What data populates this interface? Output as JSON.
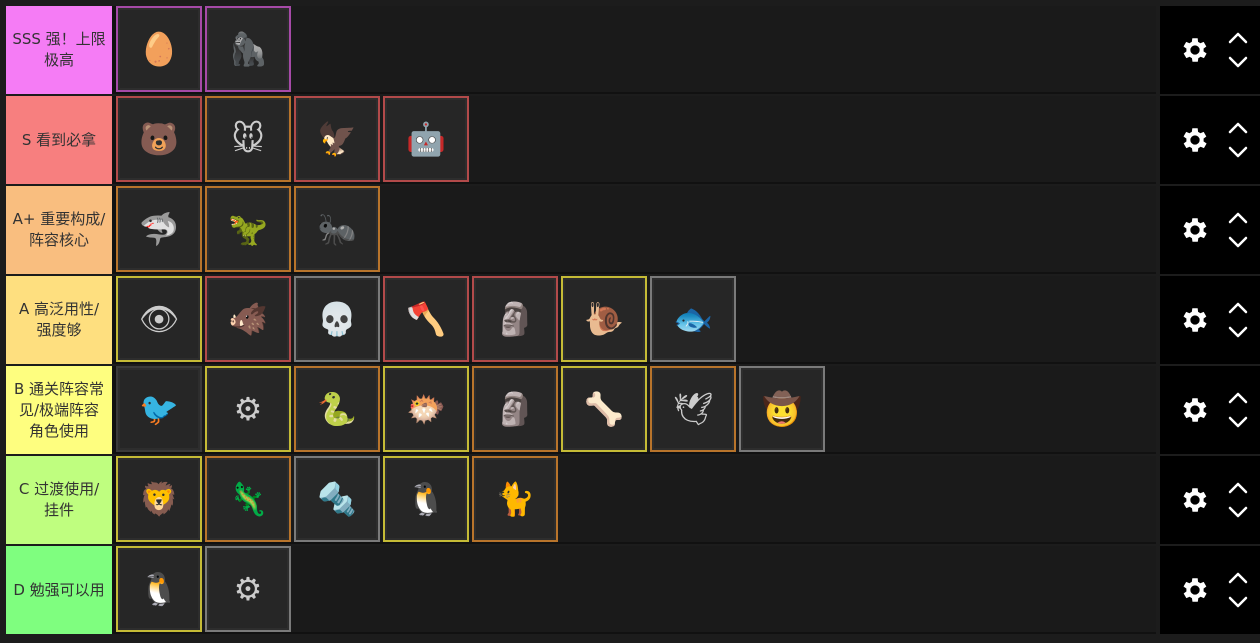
{
  "tiers": [
    {
      "label": "SSS 强！上限极高",
      "color": "#f57cf5",
      "items": [
        {
          "icon": "red-egg-pod-icon",
          "glyph": "🥚",
          "frame": "purple"
        },
        {
          "icon": "white-yeti-robot-icon",
          "glyph": "🦍",
          "frame": "purple"
        }
      ]
    },
    {
      "label": "S 看到必拿",
      "color": "#f77f7f",
      "items": [
        {
          "icon": "brown-bear-icon",
          "glyph": "🐻",
          "frame": "red"
        },
        {
          "icon": "grey-mouse-icon",
          "glyph": "🐭",
          "frame": "orange"
        },
        {
          "icon": "pterodactyl-volcano-icon",
          "glyph": "🦅",
          "frame": "red"
        },
        {
          "icon": "golden-armor-robot-icon",
          "glyph": "🤖",
          "frame": "red"
        }
      ]
    },
    {
      "label": "A+ 重要构成/阵容核心",
      "color": "#f9be7f",
      "items": [
        {
          "icon": "grey-shark-icon",
          "glyph": "🦈",
          "frame": "orange"
        },
        {
          "icon": "green-pterodactyl-icon",
          "glyph": "🦖",
          "frame": "orange"
        },
        {
          "icon": "anteater-icon",
          "glyph": "🐜",
          "frame": "orange"
        }
      ]
    },
    {
      "label": "A 高泛用性/强度够",
      "color": "#fedf7f",
      "items": [
        {
          "icon": "red-eye-drone-icon",
          "glyph": "👁",
          "frame": "yellow"
        },
        {
          "icon": "dark-horned-beast-icon",
          "glyph": "🐗",
          "frame": "red"
        },
        {
          "icon": "skeleton-cat-icon",
          "glyph": "💀",
          "frame": "grey"
        },
        {
          "icon": "axe-red-ape-icon",
          "glyph": "🪓",
          "frame": "red"
        },
        {
          "icon": "stone-golem-icon",
          "glyph": "🗿",
          "frame": "red"
        },
        {
          "icon": "snail-icon",
          "glyph": "🐌",
          "frame": "yellow"
        },
        {
          "icon": "red-anglerfish-icon",
          "glyph": "🐟",
          "frame": "grey"
        }
      ]
    },
    {
      "label": "B 通关阵容常见/极端阵容角色使用",
      "color": "#fefe7f",
      "items": [
        {
          "icon": "small-bird-icon",
          "glyph": "🐦",
          "frame": "none"
        },
        {
          "icon": "teal-machine-icon",
          "glyph": "⚙",
          "frame": "yellow"
        },
        {
          "icon": "ring-serpent-icon",
          "glyph": "🐍",
          "frame": "orange"
        },
        {
          "icon": "dark-helmet-fish-icon",
          "glyph": "🐡",
          "frame": "yellow"
        },
        {
          "icon": "dark-golem-icon",
          "glyph": "🗿",
          "frame": "orange"
        },
        {
          "icon": "skeleton-dog-icon",
          "glyph": "🦴",
          "frame": "yellow"
        },
        {
          "icon": "white-bird-icon",
          "glyph": "🕊",
          "frame": "orange"
        },
        {
          "icon": "cowboy-hat-man-icon",
          "glyph": "🤠",
          "frame": "grey"
        }
      ]
    },
    {
      "label": "C 过渡使用/挂件",
      "color": "#bffe7f",
      "items": [
        {
          "icon": "stone-lion-icon",
          "glyph": "🦁",
          "frame": "yellow"
        },
        {
          "icon": "pink-salamander-icon",
          "glyph": "🦎",
          "frame": "orange"
        },
        {
          "icon": "drill-cone-robot-icon",
          "glyph": "🔩",
          "frame": "grey"
        },
        {
          "icon": "penguin-icon",
          "glyph": "🐧",
          "frame": "yellow"
        },
        {
          "icon": "orange-cat-cart-icon",
          "glyph": "🐈",
          "frame": "orange"
        }
      ]
    },
    {
      "label": "D 勉强可以用",
      "color": "#7ffe7f",
      "items": [
        {
          "icon": "crowned-penguin-icon",
          "glyph": "🐧",
          "frame": "yellow"
        },
        {
          "icon": "gold-machine-icon",
          "glyph": "⚙",
          "frame": "grey"
        }
      ]
    }
  ]
}
